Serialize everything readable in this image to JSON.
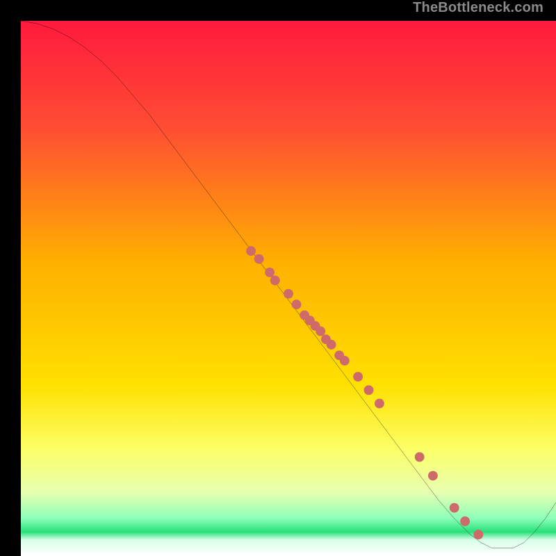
{
  "watermark": "TheBottleneck.com",
  "colors": {
    "bg": "#000000",
    "line": "#000000",
    "dot": "#cf6a6a",
    "gradient_top": "#ff1a3d",
    "gradient_mid": "#ffd400",
    "gradient_green": "#28e07a",
    "gradient_bottom": "#ffffff"
  },
  "chart_data": {
    "type": "line",
    "title": "",
    "xlabel": "",
    "ylabel": "",
    "xlim": [
      0,
      100
    ],
    "ylim": [
      0,
      100
    ],
    "series": [
      {
        "name": "curve",
        "x": [
          0,
          3,
          6,
          9,
          12,
          15,
          18,
          21,
          24,
          27,
          30,
          33,
          36,
          39,
          42,
          45,
          48,
          51,
          54,
          57,
          60,
          63,
          66,
          69,
          72,
          75,
          78,
          81,
          84,
          86,
          88,
          90,
          92,
          94,
          96,
          98,
          100
        ],
        "y": [
          100,
          99.5,
          98.5,
          97,
          95,
          92.5,
          89.5,
          86,
          82.5,
          78.5,
          74.5,
          70.5,
          66.5,
          62.5,
          58.5,
          54.5,
          50.5,
          46.5,
          42.5,
          38.5,
          34.5,
          30.5,
          26.5,
          22.5,
          18.5,
          14.5,
          10.5,
          7,
          4,
          2.5,
          1.5,
          1.5,
          1.5,
          2.5,
          4.5,
          7,
          10
        ]
      },
      {
        "name": "dots",
        "x": [
          43,
          44.5,
          46.5,
          47.5,
          50,
          51.5,
          53,
          54,
          55,
          56,
          57,
          58,
          59.5,
          60.5,
          63,
          65,
          67,
          74.5,
          77,
          81,
          83,
          85.5
        ],
        "y": [
          57,
          55.5,
          53,
          51.5,
          49,
          47,
          45,
          44,
          43,
          42,
          40.5,
          39.5,
          37.5,
          36.5,
          33.5,
          31,
          28.5,
          18.5,
          15,
          9,
          6.5,
          4
        ]
      }
    ]
  }
}
